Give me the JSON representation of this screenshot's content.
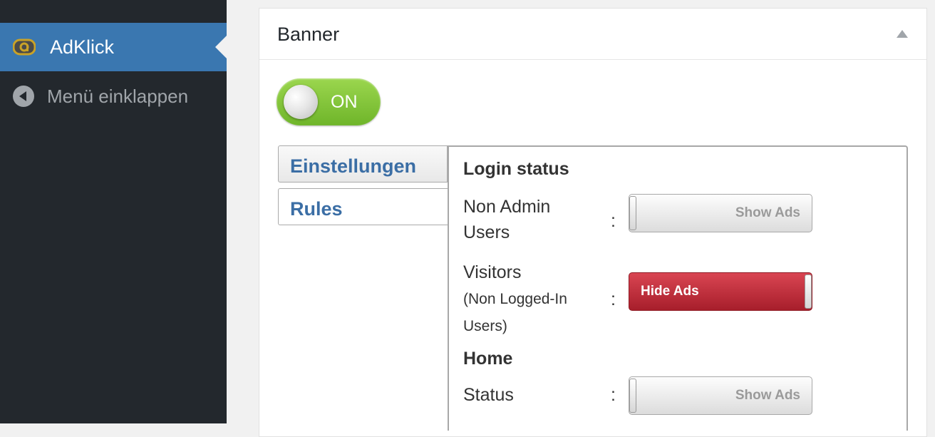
{
  "sidebar": {
    "active_item": {
      "label": "AdKlick",
      "icon": "adklick-logo-icon"
    },
    "collapse": {
      "label": "Menü einklappen",
      "icon": "arrow-left-circle-icon"
    }
  },
  "postbox": {
    "title": "Banner",
    "toggle_icon": "triangle-up-icon",
    "main_switch": {
      "label": "ON",
      "state": "on",
      "color": "#7cc23a"
    }
  },
  "tabs": [
    {
      "label": "Einstellungen",
      "active": false
    },
    {
      "label": "Rules",
      "active": true
    }
  ],
  "rules": {
    "login_status": {
      "title": "Login status",
      "non_admin": {
        "label_line1": "Non Admin",
        "label_line2": "Users",
        "colon": ":",
        "toggle_label": "Show Ads",
        "state": "show"
      },
      "visitors": {
        "label_line1": "Visitors",
        "label_line2": "(Non Logged-In",
        "label_line3": "Users)",
        "colon": ":",
        "toggle_label": "Hide Ads",
        "state": "hide",
        "color": "#c02f3b"
      }
    },
    "home": {
      "title": "Home",
      "status": {
        "label": "Status",
        "colon": ":",
        "toggle_label": "Show Ads",
        "state": "show"
      }
    }
  }
}
